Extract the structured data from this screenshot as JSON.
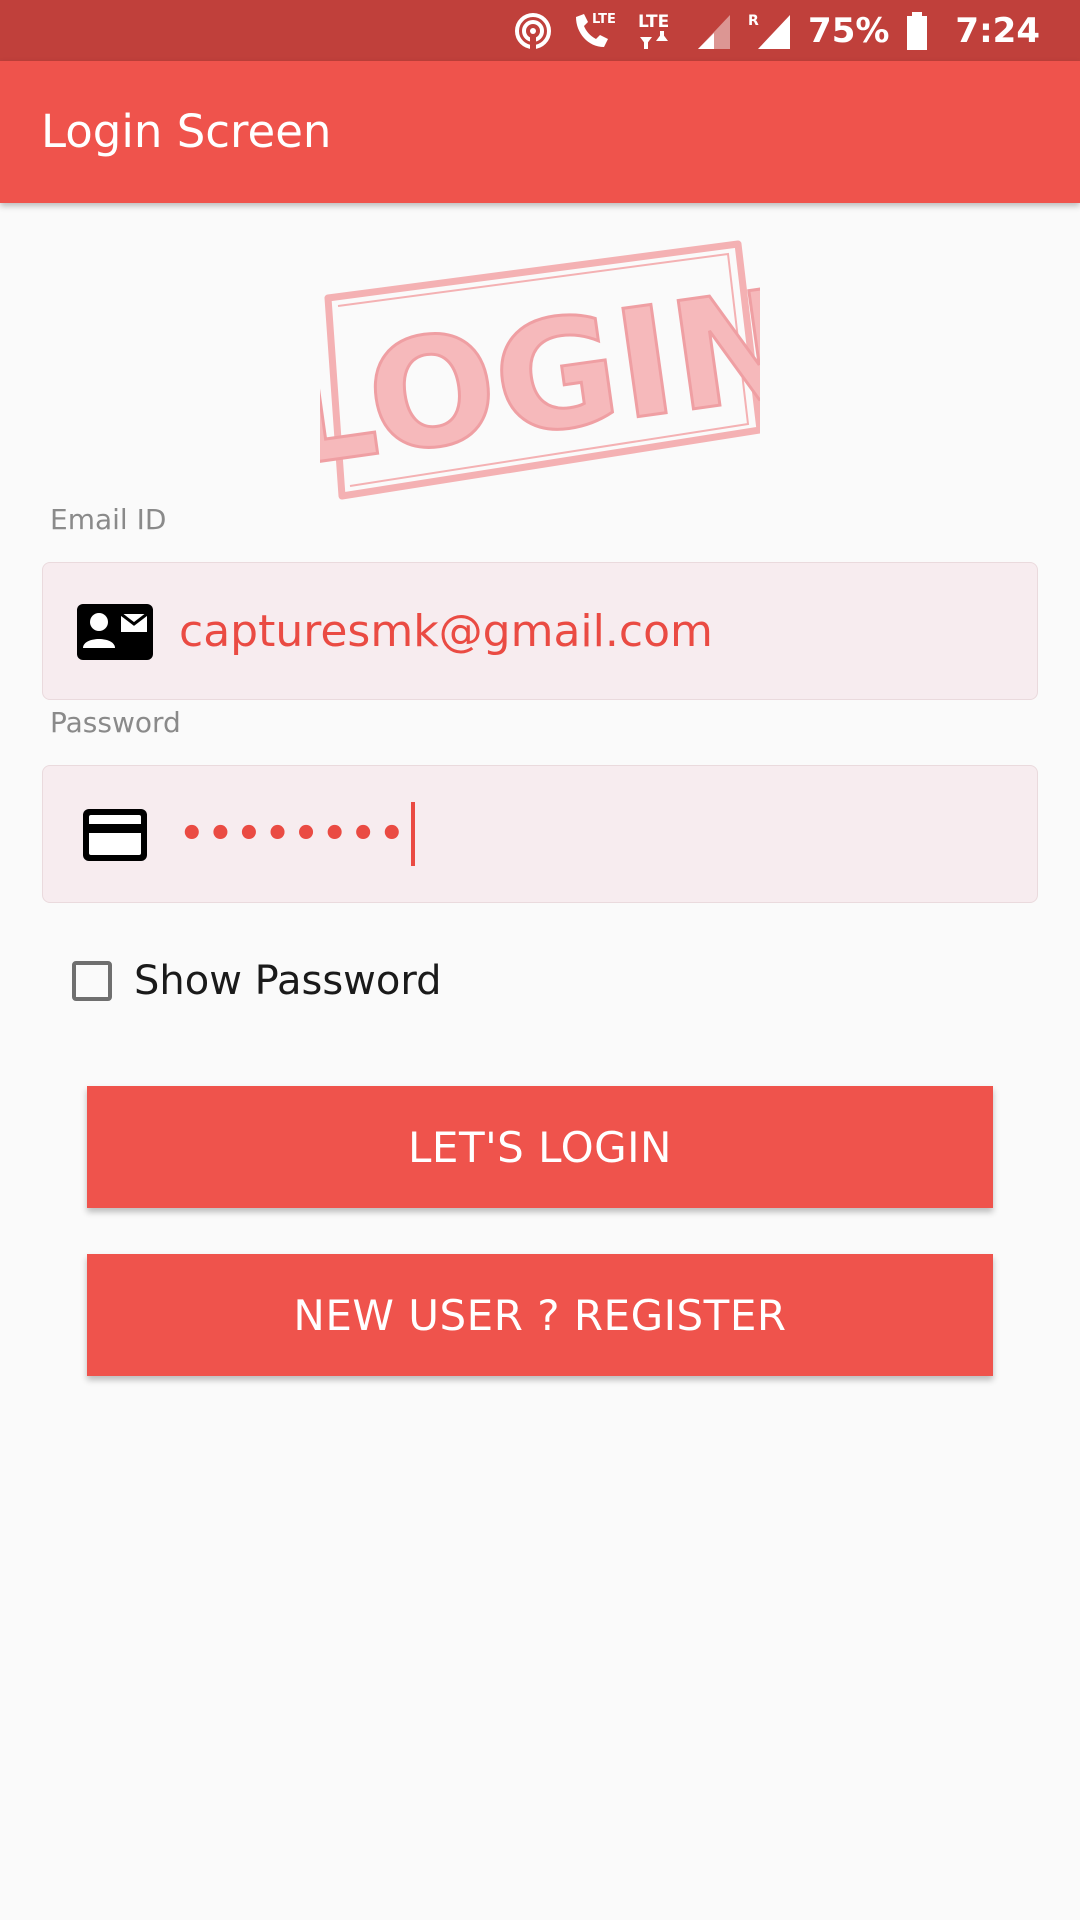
{
  "status_bar": {
    "battery": "75%",
    "time": "7:24",
    "icons": [
      "hotspot-icon",
      "lte-call-icon",
      "lte-data-icon",
      "signal-weak-icon",
      "roaming-signal-icon",
      "battery-icon"
    ],
    "lte_label": "LTE",
    "roaming_label": "R"
  },
  "app_bar": {
    "title": "Login Screen",
    "background": "#ef534c"
  },
  "logo": {
    "text": "LOGIN",
    "color": "#f4b1b3"
  },
  "form": {
    "email": {
      "label": "Email ID",
      "value": "capturesmk@gmail.com",
      "icon": "contact-card-icon"
    },
    "password": {
      "label": "Password",
      "masked_value": "••••••••",
      "icon": "credit-card-icon"
    },
    "show_password": {
      "label": "Show Password",
      "checked": false
    }
  },
  "buttons": {
    "login": "LET'S LOGIN",
    "register": "NEW USER ? REGISTER"
  },
  "colors": {
    "accent": "#ef534c",
    "status_bar": "#c0403b",
    "input_text": "#ea4b43",
    "field_bg": "#f7ecef"
  }
}
